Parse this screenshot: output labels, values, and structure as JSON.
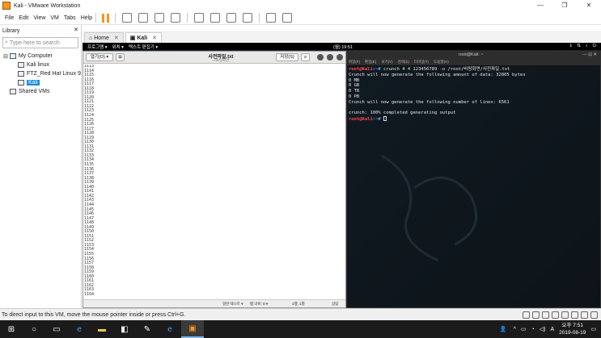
{
  "window": {
    "title": "Kali - VMware Workstation",
    "minimize": "—",
    "maximize": "❐",
    "close": "✕"
  },
  "menubar": {
    "items": [
      "File",
      "Edit",
      "View",
      "VM",
      "Tabs",
      "Help"
    ]
  },
  "library": {
    "title": "Library",
    "close": "✕",
    "search_placeholder": "Type here to search",
    "tree": [
      {
        "label": "My Computer",
        "level": 0
      },
      {
        "label": "Kali linux",
        "level": 1
      },
      {
        "label": "FTZ_Red Hat Linux 9",
        "level": 1
      },
      {
        "label": "Kali",
        "level": 1,
        "selected": true
      },
      {
        "label": "Shared VMs",
        "level": 0
      }
    ]
  },
  "tabs": [
    {
      "label": "Home",
      "close": "✕"
    },
    {
      "label": "Kali",
      "close": "✕",
      "active": true
    }
  ],
  "guest": {
    "panel": {
      "apps": "프로그램 ▾",
      "places": "위치 ▾",
      "editor": "텍스트 편집기 ▾",
      "clock": "(월) 19:51",
      "workspace": "1"
    },
    "gedit": {
      "open_btn": "열기(O) ▾",
      "title": "사전파일.txt",
      "subtitle": "~/바탕화면",
      "save_btn": "저장(S)",
      "menu_btn": "≡",
      "lines": [
        "1113",
        "1114",
        "1115",
        "1116",
        "1117",
        "1118",
        "1119",
        "1120",
        "1121",
        "1122",
        "1123",
        "1124",
        "1125",
        "1126",
        "1127",
        "1128",
        "1129",
        "1130",
        "1131",
        "1132",
        "1133",
        "1134",
        "1135",
        "1136",
        "1137",
        "1138",
        "1139",
        "1140",
        "1141",
        "1142",
        "1143",
        "1144",
        "1145",
        "1146",
        "1147",
        "1148",
        "1149",
        "1150",
        "1151",
        "1152",
        "1153",
        "1154",
        "1155",
        "1156",
        "1157",
        "1158",
        "1159",
        "1160",
        "1161",
        "1162",
        "1163",
        "1164"
      ],
      "status_lang": "일반 텍스트 ▾",
      "status_tab": "탭 너비: 8 ▾",
      "status_pos": "1행, 1열",
      "status_mode": "삽입"
    },
    "terminal": {
      "title": "root@Kali: ~",
      "controls": "—  ⊡  ✕",
      "menu": [
        "파일(F)",
        "편집(E)",
        "보기(V)",
        "검색(S)",
        "터미널(T)",
        "도움말(H)"
      ],
      "prompt_user": "root@Kali",
      "prompt_path": ":~#",
      "command": " crunch 4 4 123456789 -o /root/바탕화면/사전파일.txt",
      "output": [
        "Crunch will now generate the following amount of data: 32805 bytes",
        "0 MB",
        "0 GB",
        "0 TB",
        "0 PB",
        "Crunch will now generate the following number of lines: 6561",
        "",
        "crunch: 100% completed generating output"
      ]
    }
  },
  "vm_status": {
    "hint": "To direct input to this VM, move the mouse pointer inside or press Ctrl+G."
  },
  "taskbar": {
    "time_ampm": "오후 7:51",
    "date": "2019-08-19",
    "lang": "A",
    "notif": "▭"
  }
}
